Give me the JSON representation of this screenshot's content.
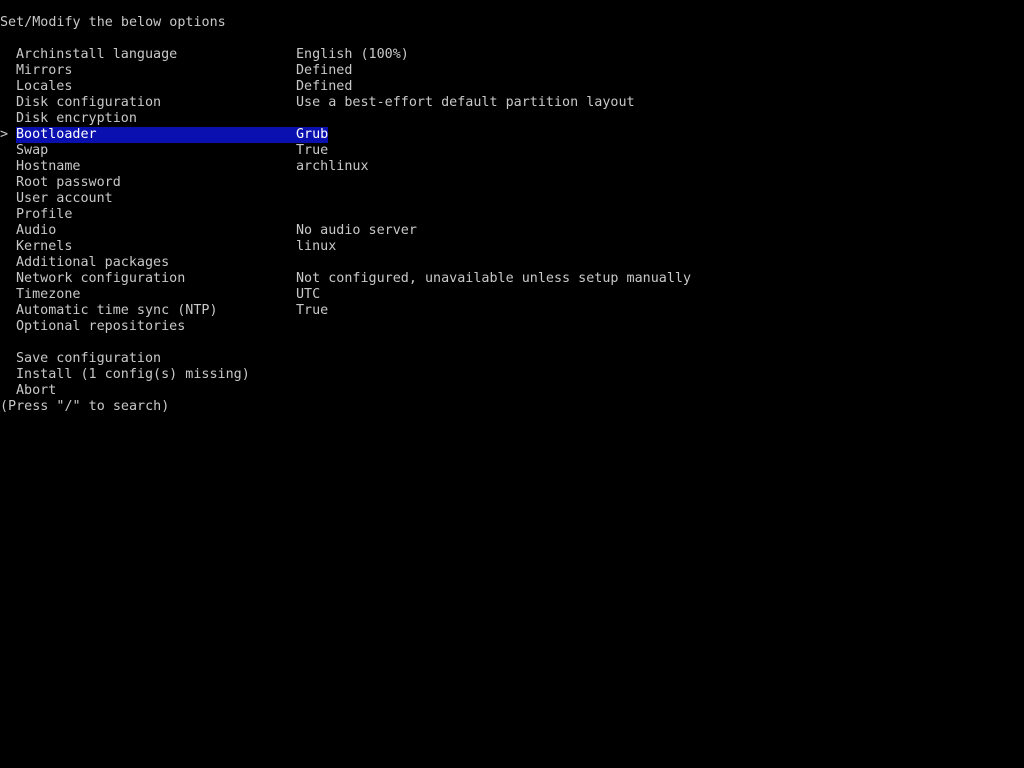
{
  "header": "Set/Modify the below options",
  "cursor_glyph": ">",
  "selection_color": "#0a10b0",
  "menu": [
    {
      "label": "Archinstall language",
      "value": "English (100%)"
    },
    {
      "label": "Mirrors",
      "value": "Defined"
    },
    {
      "label": "Locales",
      "value": "Defined"
    },
    {
      "label": "Disk configuration",
      "value": "Use a best-effort default partition layout"
    },
    {
      "label": "Disk encryption",
      "value": ""
    },
    {
      "label": "Bootloader",
      "value": "Grub"
    },
    {
      "label": "Swap",
      "value": "True"
    },
    {
      "label": "Hostname",
      "value": "archlinux"
    },
    {
      "label": "Root password",
      "value": ""
    },
    {
      "label": "User account",
      "value": ""
    },
    {
      "label": "Profile",
      "value": ""
    },
    {
      "label": "Audio",
      "value": "No audio server"
    },
    {
      "label": "Kernels",
      "value": "linux"
    },
    {
      "label": "Additional packages",
      "value": ""
    },
    {
      "label": "Network configuration",
      "value": "Not configured, unavailable unless setup manually"
    },
    {
      "label": "Timezone",
      "value": "UTC"
    },
    {
      "label": "Automatic time sync (NTP)",
      "value": "True"
    },
    {
      "label": "Optional repositories",
      "value": ""
    }
  ],
  "actions": [
    {
      "label": "Save configuration"
    },
    {
      "label": "Install (1 config(s) missing)"
    },
    {
      "label": "Abort"
    }
  ],
  "search_hint": "(Press \"/\" to search)"
}
